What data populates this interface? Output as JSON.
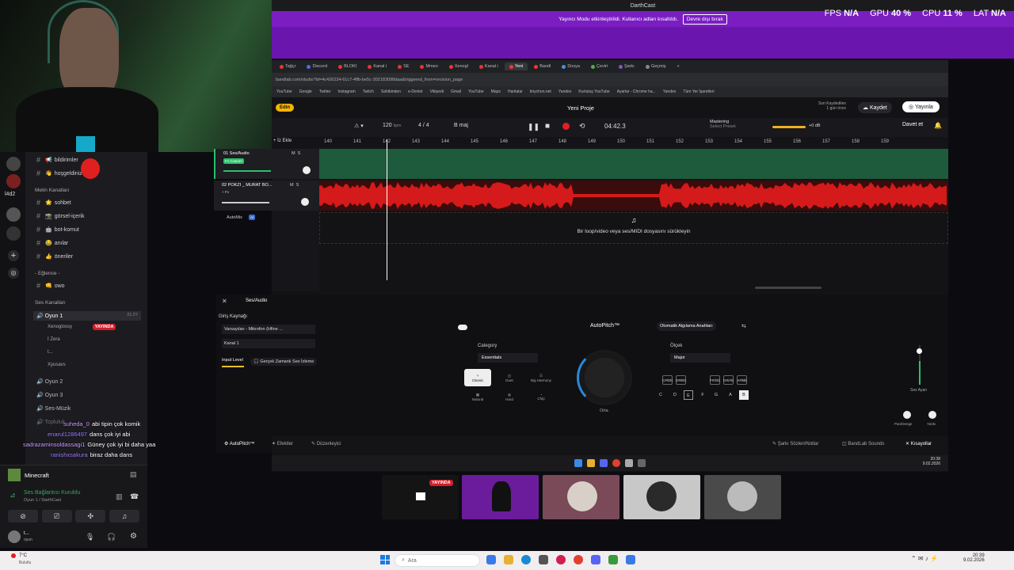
{
  "window": {
    "title": "DarthCast"
  },
  "banner": {
    "text": "Yayıncı Modu etkinleştirildi. Kullanıcı adları kısaltıldı.",
    "button": "Devre dışı bırak"
  },
  "stats": {
    "fps_label": "FPS",
    "fps": "N/A",
    "gpu_label": "GPU",
    "gpu": "40 %",
    "cpu_label": "CPU",
    "cpu": "11 %",
    "lat_label": "LAT",
    "lat": "N/A"
  },
  "discord": {
    "server_label": "l4d2",
    "channels": [
      {
        "name": "bildirimler",
        "prefix": "📢"
      },
      {
        "name": "hoşgeldiniz",
        "prefix": "👋"
      },
      {
        "name": "sohbet",
        "prefix": "🌟"
      },
      {
        "name": "görsel-içerik",
        "prefix": "📸"
      },
      {
        "name": "bot-komut",
        "prefix": "🤖"
      },
      {
        "name": "anılar",
        "prefix": "😂"
      },
      {
        "name": "öneriler",
        "prefix": "👍"
      },
      {
        "name": "owo",
        "prefix": "👊"
      }
    ],
    "category_text": "Metin Kanalları",
    "category_fun": "- Eğlence -",
    "category_voice": "Ses Kanalları",
    "voice": [
      {
        "name": "Oyun 1",
        "time": "21:27"
      },
      {
        "name": "Oyun 2"
      },
      {
        "name": "Oyun 3"
      },
      {
        "name": "Ses-Müzik"
      },
      {
        "name": "Topluluk"
      }
    ],
    "voice_users": [
      "Xenoglossy",
      "İ Zera",
      "t...",
      "Xyusavs"
    ],
    "live_label": "YAYINDA",
    "game": "Minecraft",
    "voice_status": "Ses Bağlantısı Kuruldu",
    "voice_sub": "Oyun 1 / DarthCast",
    "user_sub": "oyun"
  },
  "chat": [
    {
      "user": "suhedа_0",
      "text": "abi tipin çok komik"
    },
    {
      "user": "enarul1286497",
      "text": "dans çok iyi abi"
    },
    {
      "user": "sadrazaminsoldassagi1",
      "text": "Güney çok iyi bi daha yaa"
    },
    {
      "user": "ranishxsakura",
      "text": "biraz daha dans"
    }
  ],
  "browser": {
    "tabs": [
      "Tağçr",
      "Discord",
      "BLOKI",
      "Kanal i",
      "SE",
      "Mmeo",
      "Xenogl",
      "Kanal i",
      "Yeni",
      "Bandl",
      "Dosya",
      "Çeviri",
      "Şarkı",
      "Geçmiş"
    ],
    "url": "bandlab.com/studio?id=4c426234-61c7-4ffb-be5c-302183098daa&triggered_from=revision_page",
    "bookmarks": [
      "YouTube",
      "Google",
      "Twitter",
      "Instagram",
      "Twitch",
      "Sahibinden",
      "e-Devlet",
      "Vikipedi",
      "Gmail",
      "YouTube",
      "Maps",
      "Haritalar",
      "tinychon.net",
      "Yandex",
      "Kurtuluş YouTube",
      "Ayarlar - Chrome ha...",
      "Yandex",
      "Tüm Yer İşaretleri"
    ]
  },
  "studio": {
    "badge": "Edin",
    "project": "Yeni Proje",
    "saved_label": "Son Kaydedilen",
    "saved_time": "1 gün önce",
    "save": "Kaydet",
    "publish": "Yayınla",
    "invite": "Davet et",
    "bpm": "120",
    "bpm_unit": "bpm",
    "sig": "4 / 4",
    "key": "B maj",
    "time": "04:42.3",
    "mastering": "Mastering",
    "mastering_sub": "Select Preset",
    "db": "+0 dB",
    "add_track": "İz Ekle",
    "ruler": [
      "140",
      "141",
      "142",
      "143",
      "144",
      "145",
      "146",
      "147",
      "148",
      "149",
      "150",
      "151",
      "152",
      "153",
      "154",
      "155",
      "156",
      "157",
      "158",
      "159"
    ],
    "tracks": [
      {
        "name": "01 Ses/Audio",
        "sub": "Fx Custom"
      },
      {
        "name": "02 POKZI _ MURAT BO...",
        "sub": "+ Fx"
      }
    ],
    "automix": "AutoMix",
    "automix_badge": "AI",
    "drop_text": "Bir loop/video veya ses/MIDI dosyasını sürükleyin",
    "panel_title": "Ses/Audio",
    "input_source": "Giriş Kaynağı",
    "input_device": "Varsayılan - Mikrofon (Hfine ...",
    "channel": "Kanal 1",
    "input_level": "Input Level",
    "monitor": "Gerçek Zamanlı Ses İzleme",
    "autopitch": "AutoPitch™",
    "auto_detect": "Otomatik Algılama Anahtarı",
    "category_label": "Category",
    "category": "Essentials",
    "scale_label": "Ölçek",
    "scale": "Major",
    "cat_buttons": [
      "Classic",
      "Duet",
      "Big Harmony",
      "Natural",
      "Hard",
      "Chip"
    ],
    "knob_label": "Orta",
    "notes": [
      "C",
      "D",
      "E",
      "F",
      "G",
      "A",
      "B"
    ],
    "sharps": [
      "C#/Db",
      "D#/Eb",
      "F#/Gb",
      "G#/Ab",
      "A#/Bb"
    ],
    "level_label": "Ses Ayarı",
    "pan_label": "Pan/Denge",
    "reverb_label": "Yankı",
    "foot_tabs": [
      "AutoPitch™",
      "Efektler",
      "Düzenleyici"
    ],
    "foot_right": [
      "Şarkı Sözleri/Notlar",
      "BandLab Sounds",
      "Kısayollar"
    ],
    "inner_clock": "20:38",
    "inner_date": "9.02.2026"
  },
  "taskbar": {
    "weather": "7°C",
    "weather_sub": "Bulutlu",
    "search": "Ara",
    "clock": "20:39",
    "date": "9.02.2026"
  },
  "colors": {
    "accent": "#7a1ec2",
    "red": "#d41a1a",
    "green": "#1e5a3c"
  }
}
